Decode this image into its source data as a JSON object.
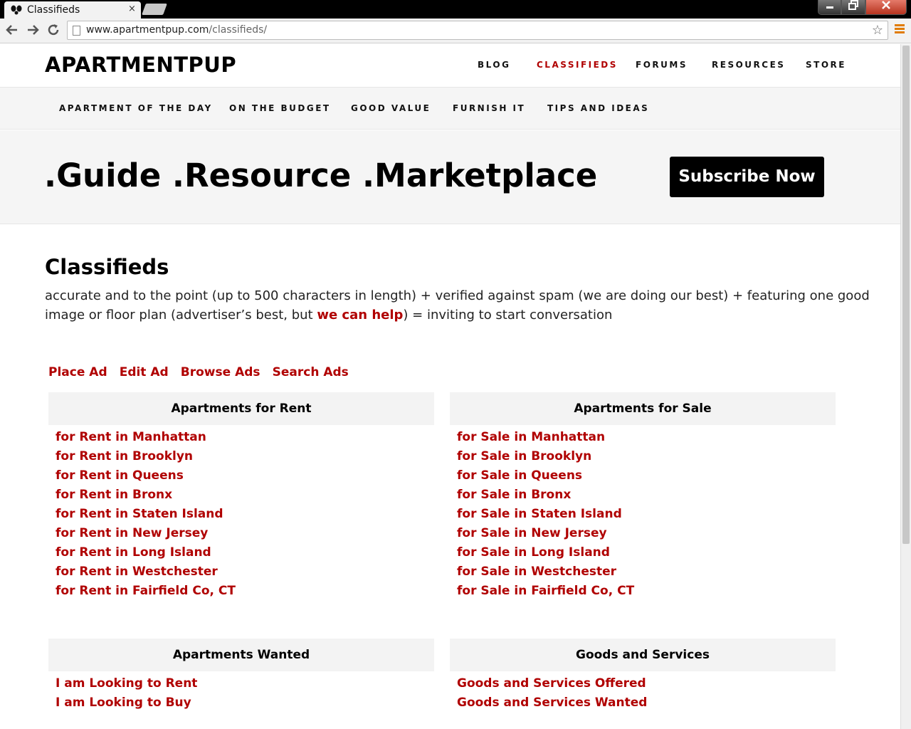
{
  "browser": {
    "tab_title": "Classifieds",
    "tab_close": "×",
    "url_domain": "www.apartmentpup.com",
    "url_path": "/classifieds/",
    "star": "☆"
  },
  "site": {
    "logo": "APARTMENTPUP",
    "main_nav": [
      "BLOG",
      "CLASSIFIEDS",
      "FORUMS",
      "RESOURCES",
      "STORE"
    ],
    "sub_nav": [
      "APARTMENT OF THE DAY",
      "ON THE BUDGET",
      "GOOD VALUE",
      "FURNISH IT",
      "TIPS AND IDEAS"
    ],
    "hero_tagline": ".Guide .Resource .Marketplace",
    "subscribe_label": "Subscribe Now"
  },
  "page": {
    "title": "Classifieds",
    "intro_before": "accurate and to the point (up to 500 characters in length) + verified against spam (we are doing our best) + featuring one good image or floor plan (advertiser’s best, but ",
    "intro_link": "we can help",
    "intro_after": ") = inviting to start conversation",
    "actions": [
      "Place Ad",
      "Edit Ad",
      "Browse Ads",
      "Search Ads"
    ]
  },
  "sections": {
    "rent": {
      "heading": "Apartments for Rent",
      "links": [
        "for Rent in Manhattan",
        "for Rent in Brooklyn",
        "for Rent in Queens",
        "for Rent in Bronx",
        "for Rent in Staten Island",
        "for Rent in New Jersey",
        "for Rent in Long Island",
        "for Rent in Westchester",
        "for Rent in Fairfield Co, CT"
      ]
    },
    "sale": {
      "heading": "Apartments for Sale",
      "links": [
        "for Sale in Manhattan",
        "for Sale in Brooklyn",
        "for Sale in Queens",
        "for Sale in Bronx",
        "for Sale in Staten Island",
        "for Sale in New Jersey",
        "for Sale in Long Island",
        "for Sale in Westchester",
        "for Sale in Fairfield Co, CT"
      ]
    },
    "wanted": {
      "heading": "Apartments Wanted",
      "links": [
        "I am Looking to Rent",
        "I am Looking to Buy"
      ]
    },
    "goods": {
      "heading": "Goods and Services",
      "links": [
        "Goods and Services Offered",
        "Goods and Services Wanted"
      ]
    }
  },
  "colors": {
    "accent": "#b00000",
    "panel": "#f5f5f5",
    "menu_icon": "#e07b00"
  }
}
